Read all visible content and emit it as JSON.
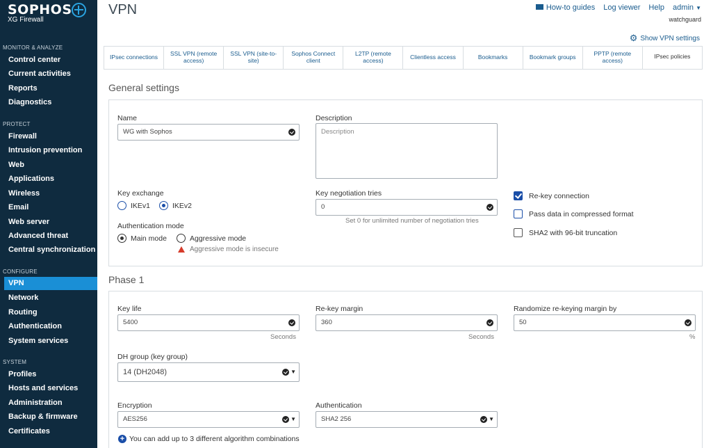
{
  "brand": {
    "name": "SOPHOS",
    "product": "XG Firewall"
  },
  "sidebar": {
    "sections": [
      {
        "title": "MONITOR & ANALYZE",
        "items": [
          "Control center",
          "Current activities",
          "Reports",
          "Diagnostics"
        ]
      },
      {
        "title": "PROTECT",
        "items": [
          "Firewall",
          "Intrusion prevention",
          "Web",
          "Applications",
          "Wireless",
          "Email",
          "Web server",
          "Advanced threat",
          "Central synchronization"
        ]
      },
      {
        "title": "CONFIGURE",
        "items": [
          "VPN",
          "Network",
          "Routing",
          "Authentication",
          "System services"
        ]
      },
      {
        "title": "SYSTEM",
        "items": [
          "Profiles",
          "Hosts and services",
          "Administration",
          "Backup & firmware",
          "Certificates"
        ]
      }
    ],
    "active": "VPN"
  },
  "header": {
    "title": "VPN",
    "howto": "How-to guides",
    "logviewer": "Log viewer",
    "help": "Help",
    "user": "admin",
    "tenant": "watchguard",
    "show_vpn_settings": "Show VPN settings"
  },
  "tabs": [
    "IPsec connections",
    "SSL VPN (remote access)",
    "SSL VPN (site-to-site)",
    "Sophos Connect client",
    "L2TP (remote access)",
    "Clientless access",
    "Bookmarks",
    "Bookmark groups",
    "PPTP (remote access)",
    "IPsec policies"
  ],
  "active_tab": "IPsec policies",
  "general": {
    "section_title": "General settings",
    "name_label": "Name",
    "name_value": "WG with Sophos",
    "description_label": "Description",
    "description_placeholder": "Description",
    "key_exchange_label": "Key exchange",
    "ikev1": "IKEv1",
    "ikev2": "IKEv2",
    "key_exchange_selected": "IKEv2",
    "key_neg_label": "Key negotiation tries",
    "key_neg_value": "0",
    "key_neg_hint": "Set 0 for unlimited number of negotiation tries",
    "auth_mode_label": "Authentication mode",
    "main_mode": "Main mode",
    "aggressive_mode": "Aggressive mode",
    "auth_mode_selected": "Main mode",
    "aggressive_warning": "Aggressive mode is insecure",
    "rekey_label": "Re-key connection",
    "rekey_checked": true,
    "compress_label": "Pass data in compressed format",
    "compress_checked": false,
    "sha2_label": "SHA2 with 96-bit truncation",
    "sha2_checked": false
  },
  "phase1": {
    "section_title": "Phase 1",
    "key_life_label": "Key life",
    "key_life_value": "5400",
    "key_life_unit": "Seconds",
    "rekey_margin_label": "Re-key margin",
    "rekey_margin_value": "360",
    "rekey_margin_unit": "Seconds",
    "randomize_label": "Randomize re-keying margin by",
    "randomize_value": "50",
    "randomize_unit": "%",
    "dh_label": "DH group (key group)",
    "dh_value": "14 (DH2048)",
    "encryption_label": "Encryption",
    "encryption_value": "AES256",
    "authentication_label": "Authentication",
    "authentication_value": "SHA2 256",
    "add_combo": "You can add up to 3 different algorithm combinations"
  },
  "colors": {
    "sidebar_bg": "#0f2b3f",
    "active_nav": "#1a8fd6",
    "link": "#1a5c8e",
    "check": "#1a4ea8",
    "warning": "#d63b2a"
  }
}
